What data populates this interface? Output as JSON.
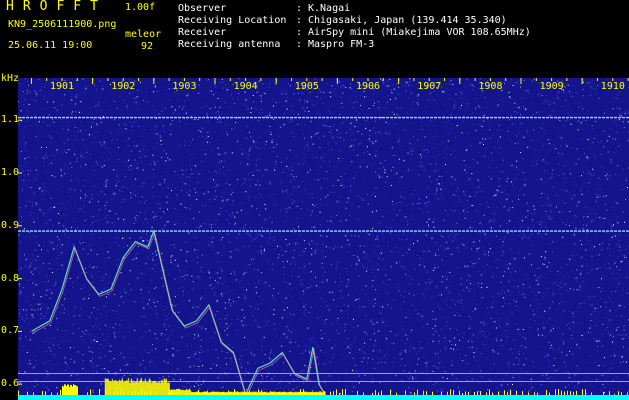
{
  "header": {
    "title": "HROFFT",
    "version": "1.00f",
    "filename": "KN9_2506111900.png",
    "timestamp": "25.06.11 19:00",
    "station_name": "meleor",
    "station_count": "92"
  },
  "info": [
    {
      "label": "Observer",
      "value": "K.Nagai"
    },
    {
      "label": "Receiving Location",
      "value": "Chigasaki, Japan (139.414 35.340)"
    },
    {
      "label": "Receiver",
      "value": "AirSpy mini (Miakejima VOR 108.65MHz)"
    },
    {
      "label": "Receiving antenna",
      "value": "Maspro FM-3"
    }
  ],
  "colors": {
    "background": "#14148c",
    "text": "#ffff00",
    "trace": "#66ddbb",
    "bars": "#ffff00",
    "floor": "#00ffff"
  },
  "chart_data": {
    "type": "heatmap",
    "yunit": "kHz",
    "ylim": [
      0.57,
      1.18
    ],
    "yticks": [
      "1.1",
      "1.0",
      "0.9",
      "0.8",
      "0.7",
      "0.6"
    ],
    "xticks": [
      "1901",
      "1902",
      "1903",
      "1904",
      "1905",
      "1906",
      "1907",
      "1908",
      "1909",
      "1910"
    ],
    "horizontal_lines_khz": [
      1.105,
      0.89,
      0.62,
      0.605
    ],
    "trace": {
      "minutes": [
        0,
        0.3,
        0.5,
        0.7,
        0.9,
        1.1,
        1.3,
        1.5,
        1.7,
        1.9,
        2.0,
        2.1,
        2.3,
        2.5,
        2.7,
        2.9,
        3.1,
        3.3,
        3.5,
        3.7,
        3.9,
        4.1,
        4.3,
        4.5,
        4.6,
        4.7,
        4.8,
        4.9,
        5.0
      ],
      "khz": [
        0.7,
        0.72,
        0.78,
        0.86,
        0.8,
        0.77,
        0.78,
        0.84,
        0.87,
        0.86,
        0.89,
        0.84,
        0.74,
        0.71,
        0.72,
        0.75,
        0.68,
        0.66,
        0.58,
        0.63,
        0.64,
        0.66,
        0.62,
        0.61,
        0.67,
        0.6,
        0.58,
        0.57,
        0.57
      ]
    },
    "bottom_activity": [
      {
        "from": 0.5,
        "to": 0.75,
        "level": 0.6
      },
      {
        "from": 1.2,
        "to": 2.25,
        "level": 0.95
      },
      {
        "from": 2.25,
        "to": 2.6,
        "level": 0.35
      },
      {
        "from": 2.6,
        "to": 4.8,
        "level": 0.2
      }
    ]
  }
}
